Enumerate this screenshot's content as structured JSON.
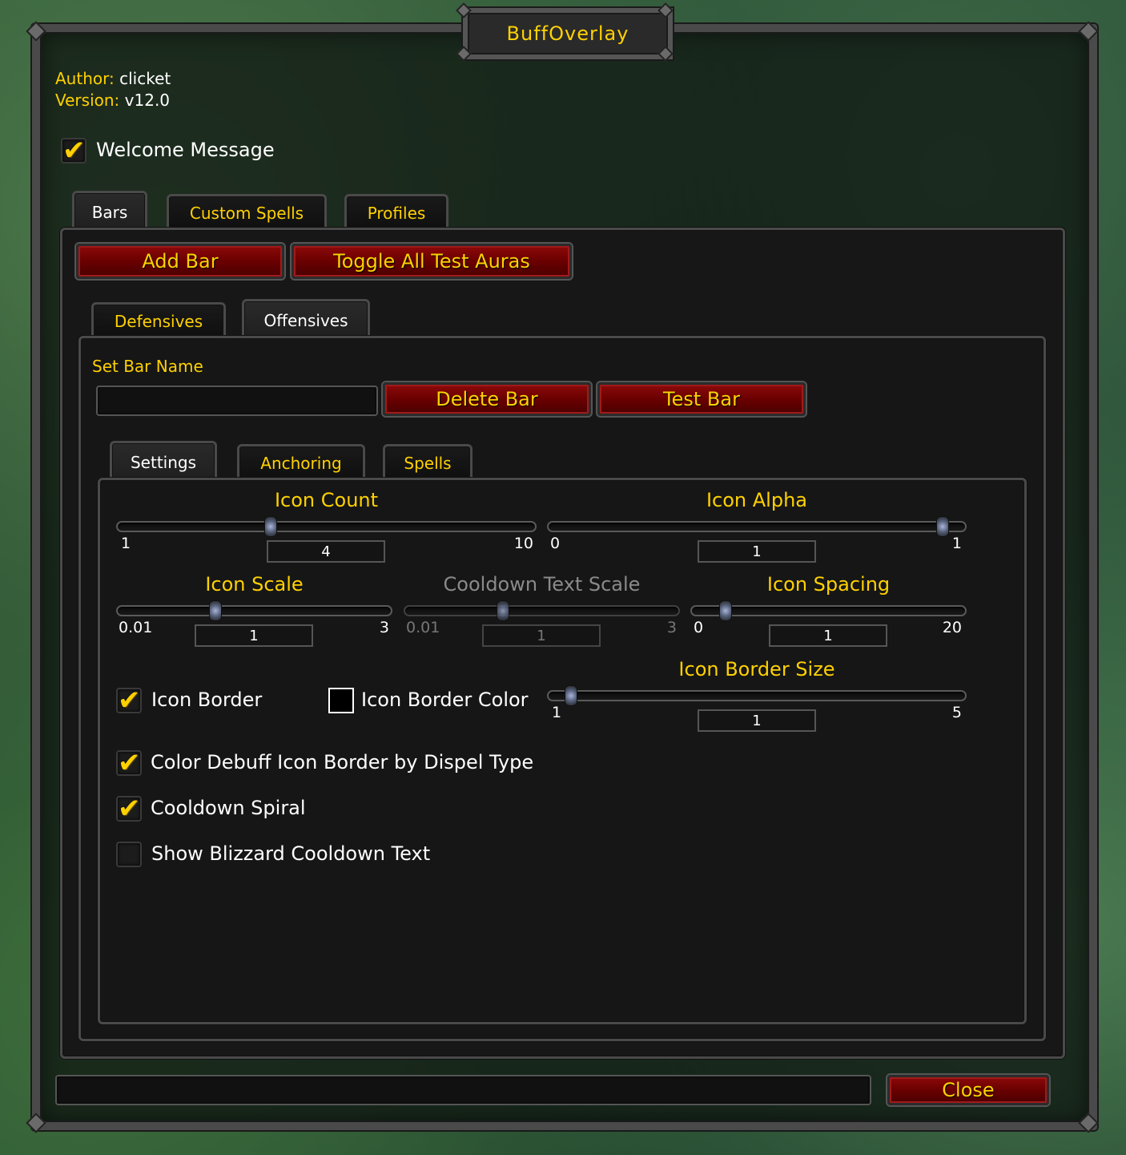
{
  "window": {
    "title": "BuffOverlay"
  },
  "info": {
    "author_label": "Author:",
    "author_value": "clicket",
    "version_label": "Version:",
    "version_value": "v12.0"
  },
  "welcome": {
    "label": "Welcome Message",
    "checked": true
  },
  "main_tabs": [
    {
      "label": "Bars",
      "active": true
    },
    {
      "label": "Custom Spells",
      "active": false
    },
    {
      "label": "Profiles",
      "active": false
    }
  ],
  "bars_toolbar": {
    "add_bar": "Add Bar",
    "toggle_all": "Toggle All Test Auras"
  },
  "bar_tabs": [
    {
      "label": "Defensives",
      "active": false
    },
    {
      "label": "Offensives",
      "active": true
    }
  ],
  "bar": {
    "name_label": "Set Bar Name",
    "name_value": "",
    "delete": "Delete Bar",
    "test": "Test Bar"
  },
  "sub_tabs": [
    {
      "label": "Settings",
      "active": true
    },
    {
      "label": "Anchoring",
      "active": false
    },
    {
      "label": "Spells",
      "active": false
    }
  ],
  "sliders": {
    "icon_count": {
      "label": "Icon Count",
      "min": "1",
      "max": "10",
      "value": "4",
      "fraction": 0.35
    },
    "icon_alpha": {
      "label": "Icon Alpha",
      "min": "0",
      "max": "1",
      "value": "1",
      "fraction": 1.0
    },
    "icon_scale": {
      "label": "Icon Scale",
      "min": "0.01",
      "max": "3",
      "value": "1",
      "fraction": 0.33
    },
    "cooldown_text_scale": {
      "label": "Cooldown Text Scale",
      "min": "0.01",
      "max": "3",
      "value": "1",
      "fraction": 0.33,
      "disabled": true
    },
    "icon_spacing": {
      "label": "Icon Spacing",
      "min": "0",
      "max": "20",
      "value": "1",
      "fraction": 0.05
    },
    "icon_border_size": {
      "label": "Icon Border Size",
      "min": "1",
      "max": "5",
      "value": "1",
      "fraction": 0.0
    }
  },
  "options": {
    "icon_border": {
      "label": "Icon Border",
      "checked": true
    },
    "icon_border_color": {
      "label": "Icon Border Color",
      "color": "#000000"
    },
    "color_debuff": {
      "label": "Color Debuff Icon Border by Dispel Type",
      "checked": true
    },
    "cooldown_spiral": {
      "label": "Cooldown Spiral",
      "checked": true
    },
    "blizzard_text": {
      "label": "Show Blizzard Cooldown Text",
      "checked": false
    }
  },
  "footer": {
    "close": "Close",
    "status": ""
  },
  "colors": {
    "accent": "#ffd100",
    "button_red": "#6a0000",
    "panel": "#161616"
  }
}
